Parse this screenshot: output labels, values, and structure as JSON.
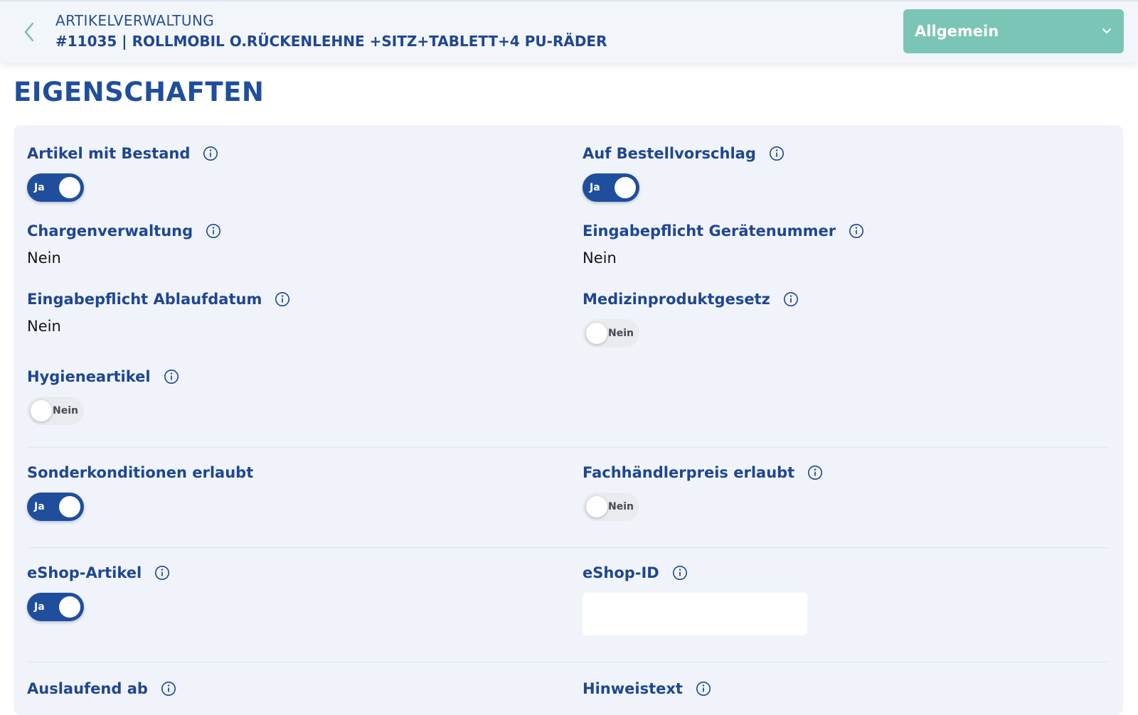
{
  "header": {
    "super_title": "ARTIKELVERWALTUNG",
    "title": "#11035 | ROLLMOBIL O.RÜCKENLEHNE +SITZ+TABLETT+4 PU-RÄDER",
    "section_select": "Allgemein"
  },
  "page": {
    "title": "EIGENSCHAFTEN"
  },
  "fields": {
    "artikel_mit_bestand": {
      "label": "Artikel mit Bestand",
      "toggle": "Ja"
    },
    "auf_bestellvorschlag": {
      "label": "Auf Bestellvorschlag",
      "toggle": "Ja"
    },
    "chargenverwaltung": {
      "label": "Chargenverwaltung",
      "value": "Nein"
    },
    "eingabepflicht_geraetenummer": {
      "label": "Eingabepflicht Gerätenummer",
      "value": "Nein"
    },
    "eingabepflicht_ablaufdatum": {
      "label": "Eingabepflicht Ablaufdatum",
      "value": "Nein"
    },
    "medizinproduktgesetz": {
      "label": "Medizinproduktgesetz",
      "toggle": "Nein"
    },
    "hygieneartikel": {
      "label": "Hygieneartikel",
      "toggle": "Nein"
    },
    "sonderkonditionen_erlaubt": {
      "label": "Sonderkonditionen erlaubt",
      "toggle": "Ja"
    },
    "fachhaendlerpreis_erlaubt": {
      "label": "Fachhändlerpreis erlaubt",
      "toggle": "Nein"
    },
    "eshop_artikel": {
      "label": "eShop-Artikel",
      "toggle": "Ja"
    },
    "eshop_id": {
      "label": "eShop-ID",
      "value": ""
    },
    "auslaufend_ab": {
      "label": "Auslaufend ab"
    },
    "hinweistext": {
      "label": "Hinweistext"
    }
  },
  "colors": {
    "brand_blue": "#1f4e9c",
    "select_green": "#7ac5b5",
    "panel_bg": "#f0f4fa"
  },
  "icons": {
    "back": "chevron-left-icon",
    "select": "chevron-down-icon",
    "info": "info-icon"
  }
}
